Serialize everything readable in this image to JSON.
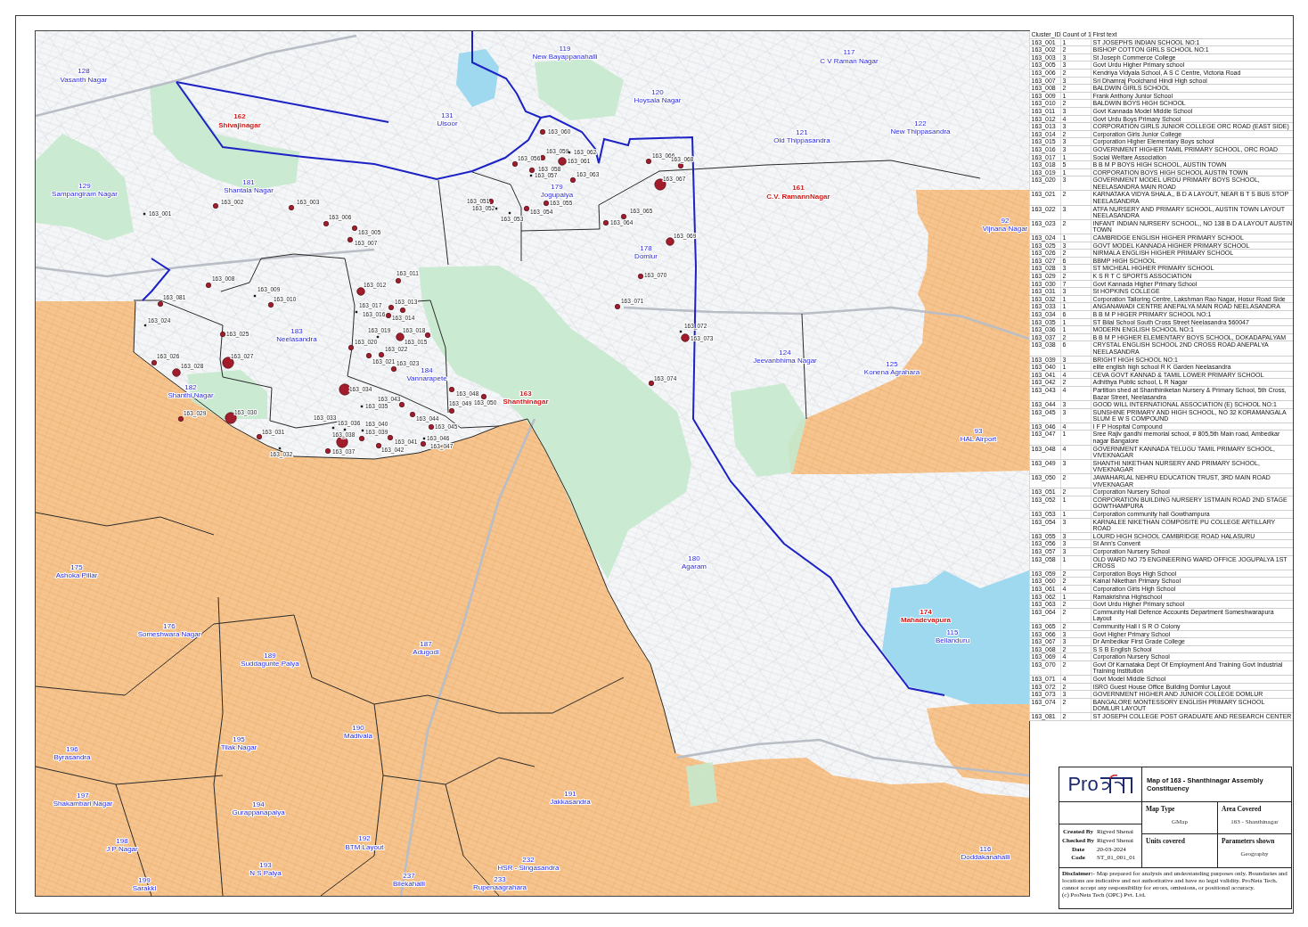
{
  "map": {
    "wards": [
      {
        "number": "119",
        "name": "New Bayappanahalli",
        "highlighted": false
      },
      {
        "number": "117",
        "name": "C V Raman Nagar",
        "highlighted": false
      },
      {
        "number": "128",
        "name": "Vasanth Nagar",
        "highlighted": false
      },
      {
        "number": "120",
        "name": "Hoysala Nagar",
        "highlighted": false
      },
      {
        "number": "162",
        "name": "Shivajinagar",
        "highlighted": true
      },
      {
        "number": "131",
        "name": "Ulsoor",
        "highlighted": false
      },
      {
        "number": "122",
        "name": "New Thippasandra",
        "highlighted": false
      },
      {
        "number": "121",
        "name": "Old Thippasandra",
        "highlighted": false
      },
      {
        "number": "129",
        "name": "Sampangiram Nagar",
        "highlighted": false
      },
      {
        "number": "181",
        "name": "Shantala Nagar",
        "highlighted": false
      },
      {
        "number": "179",
        "name": "Jogupalya",
        "highlighted": false
      },
      {
        "number": "161",
        "name": "C.V. RamannNagar",
        "highlighted": true
      },
      {
        "number": "92",
        "name": "Vijnana Nagar",
        "highlighted": false
      },
      {
        "number": "178",
        "name": "Domlur",
        "highlighted": false
      },
      {
        "number": "183",
        "name": "Neelasandra",
        "highlighted": false
      },
      {
        "number": "124",
        "name": "Jeevanbhima Nagar",
        "highlighted": false
      },
      {
        "number": "184",
        "name": "Vannarapete",
        "highlighted": false
      },
      {
        "number": "125",
        "name": "Konena Agrahara",
        "highlighted": false
      },
      {
        "number": "182",
        "name": "Shanthi Nagar",
        "highlighted": false
      },
      {
        "number": "163",
        "name": "Shanthinagar",
        "highlighted": true
      },
      {
        "number": "93",
        "name": "HAL Airport",
        "highlighted": false
      },
      {
        "number": "180",
        "name": "Agaram",
        "highlighted": false
      },
      {
        "number": "175",
        "name": "Ashoka Pillar",
        "highlighted": false
      },
      {
        "number": "174",
        "name": "Mahadevapura",
        "highlighted": true
      },
      {
        "number": "176",
        "name": "Someshwara Nagar",
        "highlighted": false
      },
      {
        "number": "115",
        "name": "Bellanduru",
        "highlighted": false
      },
      {
        "number": "187",
        "name": "Adugodi",
        "highlighted": false
      },
      {
        "number": "189",
        "name": "Suddagunte Palya",
        "highlighted": false
      },
      {
        "number": "190",
        "name": "Madivala",
        "highlighted": false
      },
      {
        "number": "195",
        "name": "Tilak Nagar",
        "highlighted": false
      },
      {
        "number": "196",
        "name": "Byrasandra",
        "highlighted": false
      },
      {
        "number": "197",
        "name": "Shakambari Nagar",
        "highlighted": false
      },
      {
        "number": "191",
        "name": "Jakkasandra",
        "highlighted": false
      },
      {
        "number": "194",
        "name": "Gurappanapalya",
        "highlighted": false
      },
      {
        "number": "198",
        "name": "J P Nagar",
        "highlighted": false
      },
      {
        "number": "192",
        "name": "BTM Layout",
        "highlighted": false
      },
      {
        "number": "116",
        "name": "Doddakanahalli",
        "highlighted": false
      },
      {
        "number": "193",
        "name": "N S Palya",
        "highlighted": false
      },
      {
        "number": "232",
        "name": "HSR - Singasandra",
        "highlighted": false
      },
      {
        "number": "199",
        "name": "Sarakki",
        "highlighted": false
      },
      {
        "number": "237",
        "name": "Bilekahalli",
        "highlighted": false
      },
      {
        "number": "233",
        "name": "Rupenaagrahara",
        "highlighted": false
      }
    ],
    "clusters": [
      {
        "label": "163_060",
        "kind": "small"
      },
      {
        "label": "163_059",
        "kind": "small"
      },
      {
        "label": "163_062",
        "kind": "point"
      },
      {
        "label": "163_056",
        "kind": "small"
      },
      {
        "label": "163_061",
        "kind": "medium"
      },
      {
        "label": "163_066",
        "kind": "small"
      },
      {
        "label": "163_068",
        "kind": "small"
      },
      {
        "label": "163_058",
        "kind": "small"
      },
      {
        "label": "163_057",
        "kind": "point"
      },
      {
        "label": "163_063",
        "kind": "small"
      },
      {
        "label": "163_067",
        "kind": "large"
      },
      {
        "label": "163_002",
        "kind": "small"
      },
      {
        "label": "163_003",
        "kind": "small"
      },
      {
        "label": "163_051",
        "kind": "small"
      },
      {
        "label": "163_055",
        "kind": "small"
      },
      {
        "label": "163_052",
        "kind": "point"
      },
      {
        "label": "163_001",
        "kind": "point"
      },
      {
        "label": "163_054",
        "kind": "small"
      },
      {
        "label": "163_053",
        "kind": "point"
      },
      {
        "label": "163_065",
        "kind": "small"
      },
      {
        "label": "163_006",
        "kind": "small"
      },
      {
        "label": "163_064",
        "kind": "small"
      },
      {
        "label": "163_005",
        "kind": "small"
      },
      {
        "label": "163_007",
        "kind": "small"
      },
      {
        "label": "163_069",
        "kind": "medium"
      },
      {
        "label": "163_011",
        "kind": "small"
      },
      {
        "label": "163_070",
        "kind": "small"
      },
      {
        "label": "163_008",
        "kind": "small"
      },
      {
        "label": "163_009",
        "kind": "point"
      },
      {
        "label": "163_012",
        "kind": "medium"
      },
      {
        "label": "163_081",
        "kind": "small"
      },
      {
        "label": "163_010",
        "kind": "small"
      },
      {
        "label": "163_017",
        "kind": "point"
      },
      {
        "label": "163_013",
        "kind": "small"
      },
      {
        "label": "163_071",
        "kind": "small"
      },
      {
        "label": "163_016",
        "kind": "small"
      },
      {
        "label": "163_014",
        "kind": "small"
      },
      {
        "label": "163_024",
        "kind": "point"
      },
      {
        "label": "163_072",
        "kind": "point"
      },
      {
        "label": "163_025",
        "kind": "small"
      },
      {
        "label": "163_019",
        "kind": "point"
      },
      {
        "label": "163_018",
        "kind": "medium"
      },
      {
        "label": "163_015",
        "kind": "small"
      },
      {
        "label": "163_073",
        "kind": "medium"
      },
      {
        "label": "163_020",
        "kind": "small"
      },
      {
        "label": "163_022",
        "kind": "small"
      },
      {
        "label": "163_026",
        "kind": "small"
      },
      {
        "label": "163_027",
        "kind": "large"
      },
      {
        "label": "163_021",
        "kind": "small"
      },
      {
        "label": "163_028",
        "kind": "medium"
      },
      {
        "label": "163_023",
        "kind": "small"
      },
      {
        "label": "163_074",
        "kind": "small"
      },
      {
        "label": "163_034",
        "kind": "large"
      },
      {
        "label": "163_048",
        "kind": "small"
      },
      {
        "label": "163_043",
        "kind": "small"
      },
      {
        "label": "163_050",
        "kind": "small"
      },
      {
        "label": "163_035",
        "kind": "point"
      },
      {
        "label": "163_049",
        "kind": "small"
      },
      {
        "label": "163_029",
        "kind": "small"
      },
      {
        "label": "163_030",
        "kind": "large"
      },
      {
        "label": "163_033",
        "kind": "point"
      },
      {
        "label": "163_044",
        "kind": "small"
      },
      {
        "label": "163_036",
        "kind": "point"
      },
      {
        "label": "163_040",
        "kind": "point"
      },
      {
        "label": "163_045",
        "kind": "small"
      },
      {
        "label": "163_031",
        "kind": "small"
      },
      {
        "label": "163_038",
        "kind": "large"
      },
      {
        "label": "163_039",
        "kind": "small"
      },
      {
        "label": "163_041",
        "kind": "small"
      },
      {
        "label": "163_046",
        "kind": "point"
      },
      {
        "label": "163_042",
        "kind": "small"
      },
      {
        "label": "163_047",
        "kind": "small"
      },
      {
        "label": "163_032",
        "kind": "point"
      },
      {
        "label": "163_037",
        "kind": "small"
      }
    ]
  },
  "cluster_table": {
    "columns": [
      "Cluster_ID",
      "Count of 1",
      "First text"
    ],
    "rows": [
      [
        "163_001",
        "1",
        "ST JOSEPH'S INDIAN SCHOOL NO:1"
      ],
      [
        "163_002",
        "2",
        "BISHOP COTTON GIRLS SCHOOL NO:1"
      ],
      [
        "163_003",
        "3",
        "St Joseph Commerce College"
      ],
      [
        "163_005",
        "3",
        "Govt Urdu Higher Primary school"
      ],
      [
        "163_006",
        "2",
        "Kendriya Vidyala School, A S C Centre, Victoria Road"
      ],
      [
        "163_007",
        "3",
        "Sri Dhamraj Poolchand Hindi High school"
      ],
      [
        "163_008",
        "2",
        "BALDWIN GIRLS SCHOOL"
      ],
      [
        "163_009",
        "1",
        "Frank Anthony Junior School"
      ],
      [
        "163_010",
        "2",
        "BALDWIN BOYS HIGH SCHOOL"
      ],
      [
        "163_011",
        "3",
        "Govt Kannada Model Middle School"
      ],
      [
        "163_012",
        "4",
        "Govt Urdu Boys Primary School"
      ],
      [
        "163_013",
        "3",
        "CORPORATION GIRLS JUNIOR COLLEGE ORC ROAD (EAST SIDE)"
      ],
      [
        "163_014",
        "2",
        "Corporation Girls Junior College"
      ],
      [
        "163_015",
        "3",
        "Corporation Higher Elementary Boys school"
      ],
      [
        "163_016",
        "3",
        "GOVERNMENT HIGHER TAMIL PRIMARY SCHOOL, ORC ROAD"
      ],
      [
        "163_017",
        "1",
        "Social Welfare Association"
      ],
      [
        "163_018",
        "5",
        "B B M P BOYS HIGH SCHOOL, AUSTIN TOWN"
      ],
      [
        "163_019",
        "1",
        "CORPORATION BOYS HIGH SCHOOL AUSTIN TOWN"
      ],
      [
        "163_020",
        "3",
        "GOVERNMENT MODEL URDU PRIMARY BOYS SCHOOL, NEELASANDRA MAIN ROAD"
      ],
      [
        "163_021",
        "2",
        "KARNATAKA VIDYA SHALA,, B D A LAYOUT, NEAR B T S BUS STOP NEELASANDRA"
      ],
      [
        "163_022",
        "3",
        "ATFA NURSERY AND PRIMARY SCHOOL, AUSTIN TOWN LAYOUT NEELASANDRA"
      ],
      [
        "163_023",
        "2",
        "INFANT INDIAN NURSERY SCHOOL,, NO 138 B D A LAYOUT AUSTIN TOWN"
      ],
      [
        "163_024",
        "1",
        "CAMBRIDGE ENGLISH HIGHER PRIMARY SCHOOL"
      ],
      [
        "163_025",
        "3",
        "GOVT MODEL KANNADA HIGHER PRIMARY SCHOOL"
      ],
      [
        "163_026",
        "2",
        "NIRMALA ENGLISH HIGHER PRIMARY SCHOOL"
      ],
      [
        "163_027",
        "6",
        "BBMP HIGH SCHOOL"
      ],
      [
        "163_028",
        "3",
        "ST MICHEAL HIGHER PRIMARY SCHOOL"
      ],
      [
        "163_029",
        "2",
        "K S R T C SPORTS ASSOCIATION"
      ],
      [
        "163_030",
        "7",
        "Govt Kannada Higher Primary School"
      ],
      [
        "163_031",
        "3",
        "St HOPKINS COLLEGE"
      ],
      [
        "163_032",
        "1",
        "Corporation Tailoring Centre, Lakshman Rao Nagar, Hosur Road Side"
      ],
      [
        "163_033",
        "1",
        "ANGANAWADI CENTRE ANEPALYA MAIN ROAD NEELASANDRA"
      ],
      [
        "163_034",
        "6",
        "B B M P HIGER PRIMARY SCHOOL NO:1"
      ],
      [
        "163_035",
        "1",
        "ST Bilal School South Cross Street Neelasandra 560047"
      ],
      [
        "163_036",
        "1",
        "MODERN ENGLISH SCHOOL NO:1"
      ],
      [
        "163_037",
        "2",
        "B B M P HIGHER ELEMENTARY BOYS SCHOOL, DOKADAPALYAM"
      ],
      [
        "163_038",
        "6",
        "CRYSTAL ENGLISH SCHOOL 2ND CROSS ROAD ANEPALYA NEELASANDRA"
      ],
      [
        "163_039",
        "3",
        "BRIGHT HIGH SCHOOL NO:1"
      ],
      [
        "163_040",
        "1",
        "elite english high school R K Garden Neelasandra"
      ],
      [
        "163_041",
        "4",
        "CEVA GOVT KANNAD & TAMIL LOWER PRIMARY SCHOOL"
      ],
      [
        "163_042",
        "2",
        "Adhithya Public school, L R Nagar"
      ],
      [
        "163_043",
        "4",
        "Partition shed at Shanthiniketan Nursery & Primary School, 5th Cross, Bazar Street, Neelasandra"
      ],
      [
        "163_044",
        "3",
        "GOOD WILL INTERNATIONAL ASSOCIATION (E) SCHOOL NO:1"
      ],
      [
        "163_045",
        "3",
        "SUNSHINE PRIMARY AND HIGH SCHOOL, NO 32 KORAMANGALA SLUM E W S COMPOUND"
      ],
      [
        "163_046",
        "4",
        "I F P Hospital Compound"
      ],
      [
        "163_047",
        "1",
        "Sree Rajiv gandhi memorial school, # 805,5th Main road, Ambedkar nagar Bangalore"
      ],
      [
        "163_048",
        "4",
        "GOVERNMENT KANNADA TELUGU TAMIL PRIMARY SCHOOL, VIVEKNAGAR"
      ],
      [
        "163_049",
        "3",
        "SHANTHI NIKETHAN NURSERY AND PRIMARY SCHOOL, VIVEKNAGAR"
      ],
      [
        "163_050",
        "2",
        "JAWAHARLAL NEHRU EDUCATION TRUST, 3RD MAIN ROAD VIVEKNAGAR"
      ],
      [
        "163_051",
        "2",
        "Corporation Nursery School"
      ],
      [
        "163_052",
        "1",
        "CORPORATION BUILDING NURSERY 1STMAIN ROAD 2ND STAGE GOWTHAMPURA"
      ],
      [
        "163_053",
        "1",
        "Corporation community hall Gowthampura"
      ],
      [
        "163_054",
        "3",
        "KARNALEE NIKETHAN COMPOSITE PU COLLEGE ARTILLARY ROAD"
      ],
      [
        "163_055",
        "3",
        "LOURD HIGH SCHOOL CAMBRIDGE ROAD HALASURU"
      ],
      [
        "163_056",
        "3",
        "St Ann's Convent"
      ],
      [
        "163_057",
        "3",
        "Corporation Nursery School"
      ],
      [
        "163_058",
        "1",
        "OLD WARD NO 75 ENGINEERING WARD OFFICE JOGUPALYA 1ST CROSS"
      ],
      [
        "163_059",
        "2",
        "Corporation Boys High School"
      ],
      [
        "163_060",
        "2",
        "Kainal Nikethan Primary School"
      ],
      [
        "163_061",
        "4",
        "Corporation Girls High School"
      ],
      [
        "163_062",
        "1",
        "Ramakrishna Highschool"
      ],
      [
        "163_063",
        "2",
        "Govt Urdu Higher Primary school"
      ],
      [
        "163_064",
        "2",
        "Community Hall Defence Accounts Department Someshwarapura Layout"
      ],
      [
        "163_065",
        "2",
        "Community Hall I S R O Colony"
      ],
      [
        "163_066",
        "3",
        "Govt Higher Primary School"
      ],
      [
        "163_067",
        "3",
        "Dr Ambedkar First Grade College"
      ],
      [
        "163_068",
        "2",
        "S S B English School"
      ],
      [
        "163_069",
        "4",
        "Corporation Nursery School"
      ],
      [
        "163_070",
        "2",
        "Govt Of Karnataka Dept Of Employment And Training Govt Industrial Training Institution"
      ],
      [
        "163_071",
        "4",
        "Govt Model Middle School"
      ],
      [
        "163_072",
        "2",
        "ISRO Guest House Office Building Domlur Layout"
      ],
      [
        "163_073",
        "3",
        "GOVERNMENT HIGHER AND JUNIOR COLLEGE DOMLUR"
      ],
      [
        "163_074",
        "2",
        "BANGALORE MONTESSORY ENGLISH PRIMARY SCHOOL DOMLUR LAYOUT"
      ],
      [
        "163_081",
        "2",
        "ST JOSEPH COLLEGE POST GRADUATE AND RESEARCH CENTER"
      ]
    ]
  },
  "title_block": {
    "logo": "Pro",
    "title": "Map of 163 - Shanthinagar Assembly Constituency",
    "details": [
      {
        "label": "Created By",
        "value": "Rigved Shenai"
      },
      {
        "label": "Checked By",
        "value": "Rigved Shenai"
      },
      {
        "label": "Date",
        "value": "20-03-2024"
      },
      {
        "label": "Code",
        "value": "ST_01_001_01"
      }
    ],
    "fields": [
      {
        "label": "Map Type",
        "value": "GMap"
      },
      {
        "label": "Area Covered",
        "value": "163 - Shanthinagar"
      },
      {
        "label": "Units covered"
      },
      {
        "label": "Parameters shown",
        "value": "Geography"
      }
    ],
    "disclaimer": "**Disclaimer:-** Map prepared for analysis and understanding purposes only. Boundaries and locations are indicative and not authoritative and have no legal validity. ProNeta Tech. cannot accept any responsibility for errors, omissions, or positional accuracy.",
    "copyright": "(c) ProNeta Tech (OPC) Pvt. Ltd."
  }
}
